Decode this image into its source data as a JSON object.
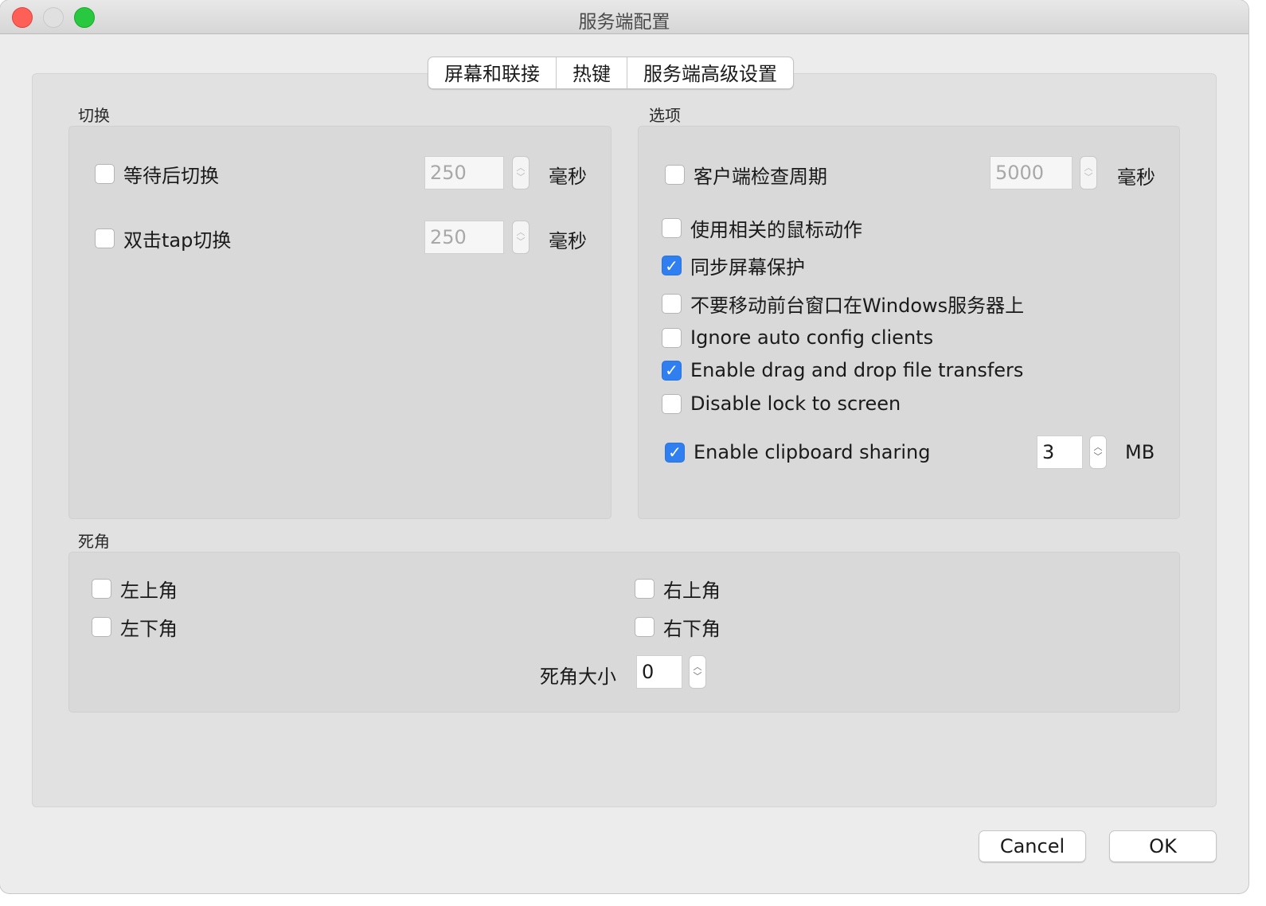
{
  "window": {
    "title": "服务端配置"
  },
  "tabs": [
    {
      "label": "屏幕和联接"
    },
    {
      "label": "热键"
    },
    {
      "label": "服务端高级设置"
    }
  ],
  "switch_group": {
    "title": "切换",
    "wait_switch": {
      "label": "等待后切换",
      "checked": false,
      "value": "250",
      "unit": "毫秒"
    },
    "double_tap": {
      "label": "双击tap切换",
      "checked": false,
      "value": "250",
      "unit": "毫秒"
    }
  },
  "options_group": {
    "title": "选项",
    "client_check": {
      "label": "客户端检查周期",
      "checked": false,
      "value": "5000",
      "unit": "毫秒"
    },
    "items": [
      {
        "label": "使用相关的鼠标动作",
        "checked": false
      },
      {
        "label": "同步屏幕保护",
        "checked": true
      },
      {
        "label": "不要移动前台窗口在Windows服务器上",
        "checked": false
      },
      {
        "label": "Ignore auto config clients",
        "checked": false
      },
      {
        "label": "Enable drag and drop file transfers",
        "checked": true
      },
      {
        "label": "Disable lock to screen",
        "checked": false
      }
    ],
    "clipboard": {
      "label": "Enable clipboard sharing",
      "checked": true,
      "value": "3",
      "unit": "MB"
    }
  },
  "dead_corners": {
    "title": "死角",
    "top_left": {
      "label": "左上角",
      "checked": false
    },
    "bottom_left": {
      "label": "左下角",
      "checked": false
    },
    "top_right": {
      "label": "右上角",
      "checked": false
    },
    "bottom_right": {
      "label": "右下角",
      "checked": false
    },
    "size_label": "死角大小",
    "size_value": "0"
  },
  "buttons": {
    "cancel": "Cancel",
    "ok": "OK"
  },
  "colors": {
    "accent": "#2f7ff0",
    "window_bg": "#ececec"
  }
}
